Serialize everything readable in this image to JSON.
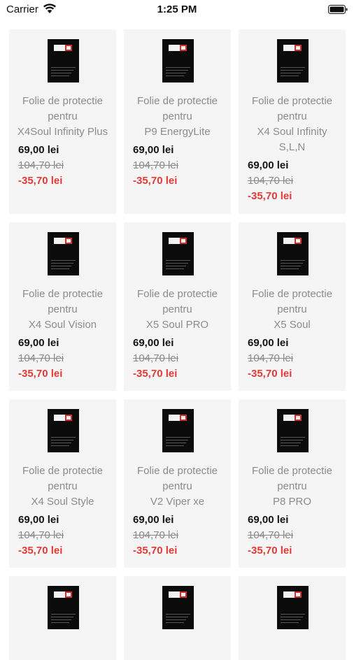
{
  "status_bar": {
    "carrier": "Carrier",
    "time": "1:25 PM"
  },
  "colors": {
    "card_bg": "#f5f5f5",
    "discount": "#e53935",
    "old_price": "#8a8a8a",
    "name": "#8c8c8c"
  },
  "products": [
    {
      "name": "Folie de protectie\npentru\nX4Soul Infinity Plus",
      "price": "69,00 lei",
      "old_price": "104,70 lei",
      "discount": "-35,70 lei"
    },
    {
      "name": "Folie de protectie\npentru\nP9 EnergyLite",
      "price": "69,00 lei",
      "old_price": "104,70 lei",
      "discount": "-35,70 lei"
    },
    {
      "name": "Folie de protectie\npentru\nX4 Soul Infinity\nS,L,N",
      "price": "69,00 lei",
      "old_price": "104,70 lei",
      "discount": "-35,70 lei"
    },
    {
      "name": "Folie de protectie\npentru\nX4 Soul Vision",
      "price": "69,00 lei",
      "old_price": "104,70 lei",
      "discount": "-35,70 lei"
    },
    {
      "name": "Folie de protectie\npentru\nX5 Soul PRO",
      "price": "69,00 lei",
      "old_price": "104,70 lei",
      "discount": "-35,70 lei"
    },
    {
      "name": "Folie de protectie\npentru\nX5 Soul",
      "price": "69,00 lei",
      "old_price": "104,70 lei",
      "discount": "-35,70 lei"
    },
    {
      "name": "Folie de protectie\npentru\nX4 Soul Style",
      "price": "69,00 lei",
      "old_price": "104,70 lei",
      "discount": "-35,70 lei"
    },
    {
      "name": "Folie de protectie\npentru\nV2 Viper xe",
      "price": "69,00 lei",
      "old_price": "104,70 lei",
      "discount": "-35,70 lei"
    },
    {
      "name": "Folie de protectie\npentru\nP8 PRO",
      "price": "69,00 lei",
      "old_price": "104,70 lei",
      "discount": "-35,70 lei"
    },
    {
      "name": "",
      "price": "",
      "old_price": "",
      "discount": ""
    },
    {
      "name": "",
      "price": "",
      "old_price": "",
      "discount": ""
    },
    {
      "name": "",
      "price": "",
      "old_price": "",
      "discount": ""
    }
  ]
}
